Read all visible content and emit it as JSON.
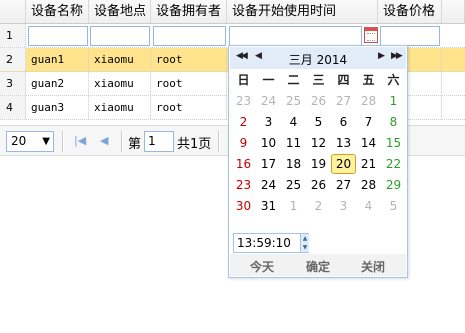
{
  "grid": {
    "headers": [
      "",
      "设备名称",
      "设备地点",
      "设备拥有者",
      "设备开始使用时间",
      "设备价格",
      ""
    ],
    "rows": [
      {
        "num": "1",
        "name": "",
        "location": "",
        "owner": "",
        "start": "",
        "price": ""
      },
      {
        "num": "2",
        "name": "guan1",
        "location": "xiaomu",
        "owner": "root",
        "start": "",
        "price": ""
      },
      {
        "num": "3",
        "name": "guan2",
        "location": "xiaomu",
        "owner": "root",
        "start": "",
        "price": ""
      },
      {
        "num": "4",
        "name": "guan3",
        "location": "xiaomu",
        "owner": "root",
        "start": "",
        "price": ""
      }
    ],
    "selected_row": 2
  },
  "pager": {
    "page_size": "20",
    "page_prefix": "第",
    "page_value": "1",
    "page_total": "共1页"
  },
  "calendar": {
    "month": "三月",
    "year": "2014",
    "weekdays": [
      "日",
      "一",
      "二",
      "三",
      "四",
      "五",
      "六"
    ],
    "weeks": [
      [
        "23",
        "24",
        "25",
        "26",
        "27",
        "28",
        "1"
      ],
      [
        "2",
        "3",
        "4",
        "5",
        "6",
        "7",
        "8"
      ],
      [
        "9",
        "10",
        "11",
        "12",
        "13",
        "14",
        "15"
      ],
      [
        "16",
        "17",
        "18",
        "19",
        "20",
        "21",
        "22"
      ],
      [
        "23",
        "24",
        "25",
        "26",
        "27",
        "28",
        "29"
      ],
      [
        "30",
        "31",
        "1",
        "2",
        "3",
        "4",
        "5"
      ]
    ],
    "highlighted_day": "20",
    "time": "13:59:10",
    "buttons": {
      "today": "今天",
      "ok": "确定",
      "close": "关闭"
    },
    "colors": {
      "sunday": "#c00000",
      "saturday": "#2aa02a",
      "today_bg": "#fff3a0",
      "selected_row": "#ffe48d"
    }
  }
}
